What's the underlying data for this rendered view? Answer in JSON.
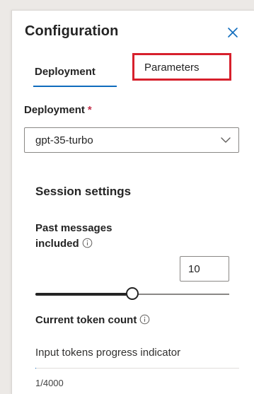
{
  "panel": {
    "title": "Configuration",
    "close_icon": "close-icon"
  },
  "tabs": [
    {
      "label": "Deployment",
      "selected": true
    },
    {
      "label": "Parameters",
      "selected": false,
      "highlighted": true
    }
  ],
  "deployment": {
    "label": "Deployment",
    "required_marker": "*",
    "selected_value": "gpt-35-turbo",
    "dropdown_icon": "chevron-down-icon"
  },
  "session": {
    "title": "Session settings",
    "past_messages": {
      "label": "Past messages included",
      "info_icon": "info-icon",
      "value": "10",
      "slider_fraction": 0.5
    },
    "token_count": {
      "label": "Current token count",
      "info_icon": "info-icon",
      "progress_label": "Input tokens progress indicator",
      "progress_fraction": 0.00025,
      "value": "1/4000"
    }
  },
  "colors": {
    "accent": "#0f6cbd",
    "highlight_box": "#d7202c",
    "required": "#c4314b"
  }
}
